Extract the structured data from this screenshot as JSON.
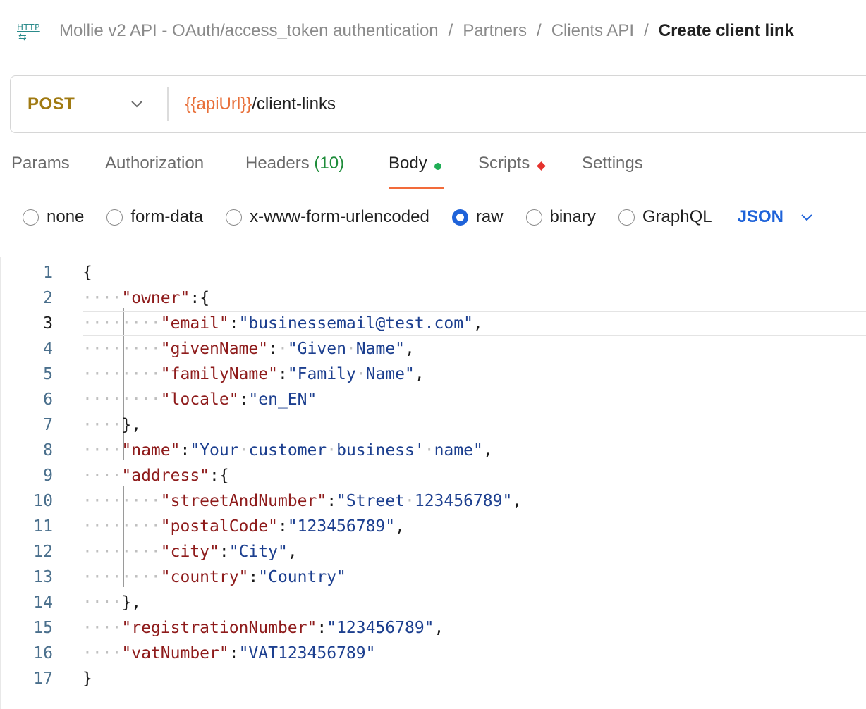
{
  "breadcrumb": {
    "icon": "http-icon",
    "icon_text": "HTTP",
    "items": [
      "Mollie v2 API - OAuth/access_token authentication",
      "Partners",
      "Clients API"
    ],
    "current": "Create client link",
    "separator": "/"
  },
  "request": {
    "method": "POST",
    "url_variable": "{{apiUrl}}",
    "url_path": "/client-links"
  },
  "tabs": {
    "params": "Params",
    "authorization": "Authorization",
    "headers": "Headers",
    "headers_count": "(10)",
    "body": "Body",
    "scripts": "Scripts",
    "settings": "Settings",
    "active": "Body"
  },
  "body_types": {
    "none": "none",
    "form_data": "form-data",
    "urlencoded": "x-www-form-urlencoded",
    "raw": "raw",
    "binary": "binary",
    "graphql": "GraphQL",
    "selected": "raw",
    "language": "JSON"
  },
  "editor": {
    "active_line": 3,
    "lines": [
      "{",
      "    \"owner\":{",
      "        \"email\":\"businessemail@test.com\",",
      "        \"givenName\": \"Given Name\",",
      "        \"familyName\":\"Family Name\",",
      "        \"locale\":\"en_EN\"",
      "    },",
      "    \"name\":\"Your customer business' name\",",
      "    \"address\":{",
      "        \"streetAndNumber\":\"Street 123456789\",",
      "        \"postalCode\":\"123456789\",",
      "        \"city\":\"City\",",
      "        \"country\":\"Country\"",
      "    },",
      "    \"registrationNumber\":\"123456789\",",
      "    \"vatNumber\":\"VAT123456789\"",
      "}"
    ]
  },
  "colors": {
    "method": "#a07a12",
    "url_variable": "#e8703a",
    "tab_underline": "#f26b3a",
    "headers_count": "#1e8c3a",
    "body_dot": "#1fae55",
    "scripts_marker": "#e5322d",
    "radio_selected": "#1f63d9",
    "json_key": "#8e1b1b",
    "json_string": "#1c3f8f",
    "line_number": "#4a6f8c"
  }
}
